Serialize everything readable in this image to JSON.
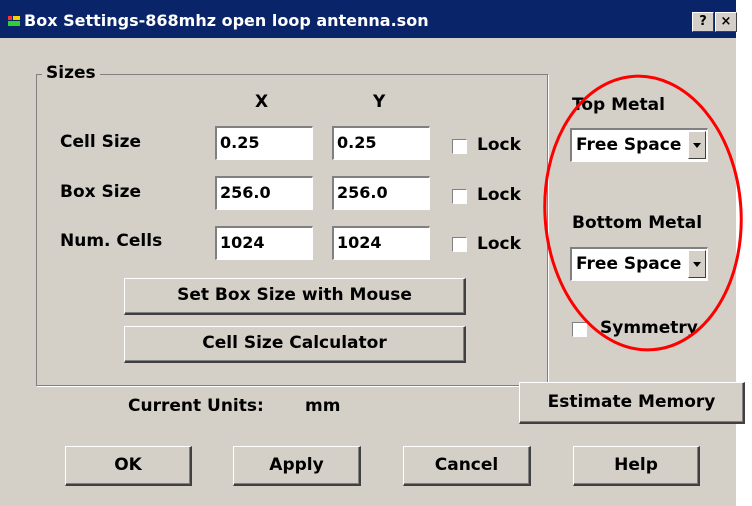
{
  "window": {
    "title": "Box Settings-868mhz open loop antenna.son",
    "help_button": "?",
    "close_button": "×"
  },
  "sizes": {
    "group_label": "Sizes",
    "col_x": "X",
    "col_y": "Y",
    "rows": [
      {
        "label": "Cell Size",
        "x": "0.25",
        "y": "0.25",
        "lock_label": "Lock",
        "locked": false
      },
      {
        "label": "Box Size",
        "x": "256.0",
        "y": "256.0",
        "lock_label": "Lock",
        "locked": false
      },
      {
        "label": "Num. Cells",
        "x": "1024",
        "y": "1024",
        "lock_label": "Lock",
        "locked": false
      }
    ],
    "set_box_size_button": "Set Box Size with Mouse",
    "cell_size_calculator_button": "Cell Size Calculator"
  },
  "metals": {
    "top_label": "Top Metal",
    "top_value": "Free Space",
    "bottom_label": "Bottom Metal",
    "bottom_value": "Free Space",
    "symmetry_label": "Symmetry",
    "symmetry_checked": false
  },
  "units": {
    "label": "Current Units:",
    "value": "mm"
  },
  "estimate_memory_button": "Estimate Memory",
  "buttons": {
    "ok": "OK",
    "apply": "Apply",
    "cancel": "Cancel",
    "help": "Help"
  },
  "annotation": {
    "shape": "ellipse",
    "color": "#ff0000"
  }
}
